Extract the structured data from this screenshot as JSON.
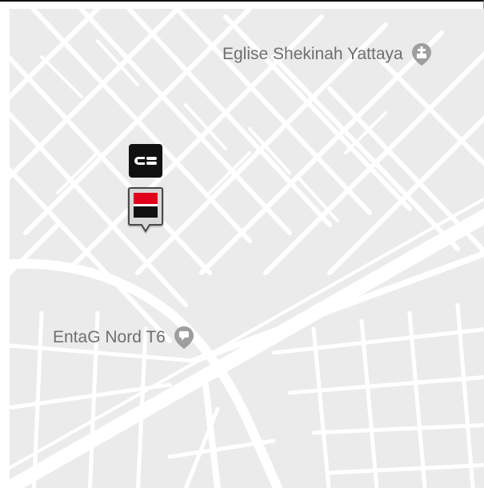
{
  "map": {
    "pois": [
      {
        "label": "Eglise Shekinah Yattaya",
        "icon": "church-pin-icon"
      },
      {
        "label": "EntaG Nord T6",
        "icon": "chat-bubble-pin-icon"
      }
    ],
    "markers": [
      {
        "type": "atm-card-marker",
        "icon": "credit-card-icon"
      },
      {
        "type": "bank-branch-marker",
        "icon": "bank-logo-icon"
      }
    ],
    "colors": {
      "land": "#ebebeb",
      "street": "#ffffff",
      "label": "#6f6f6f",
      "poi_pin": "#9e9e9e",
      "bank_red": "#e2001a"
    }
  }
}
